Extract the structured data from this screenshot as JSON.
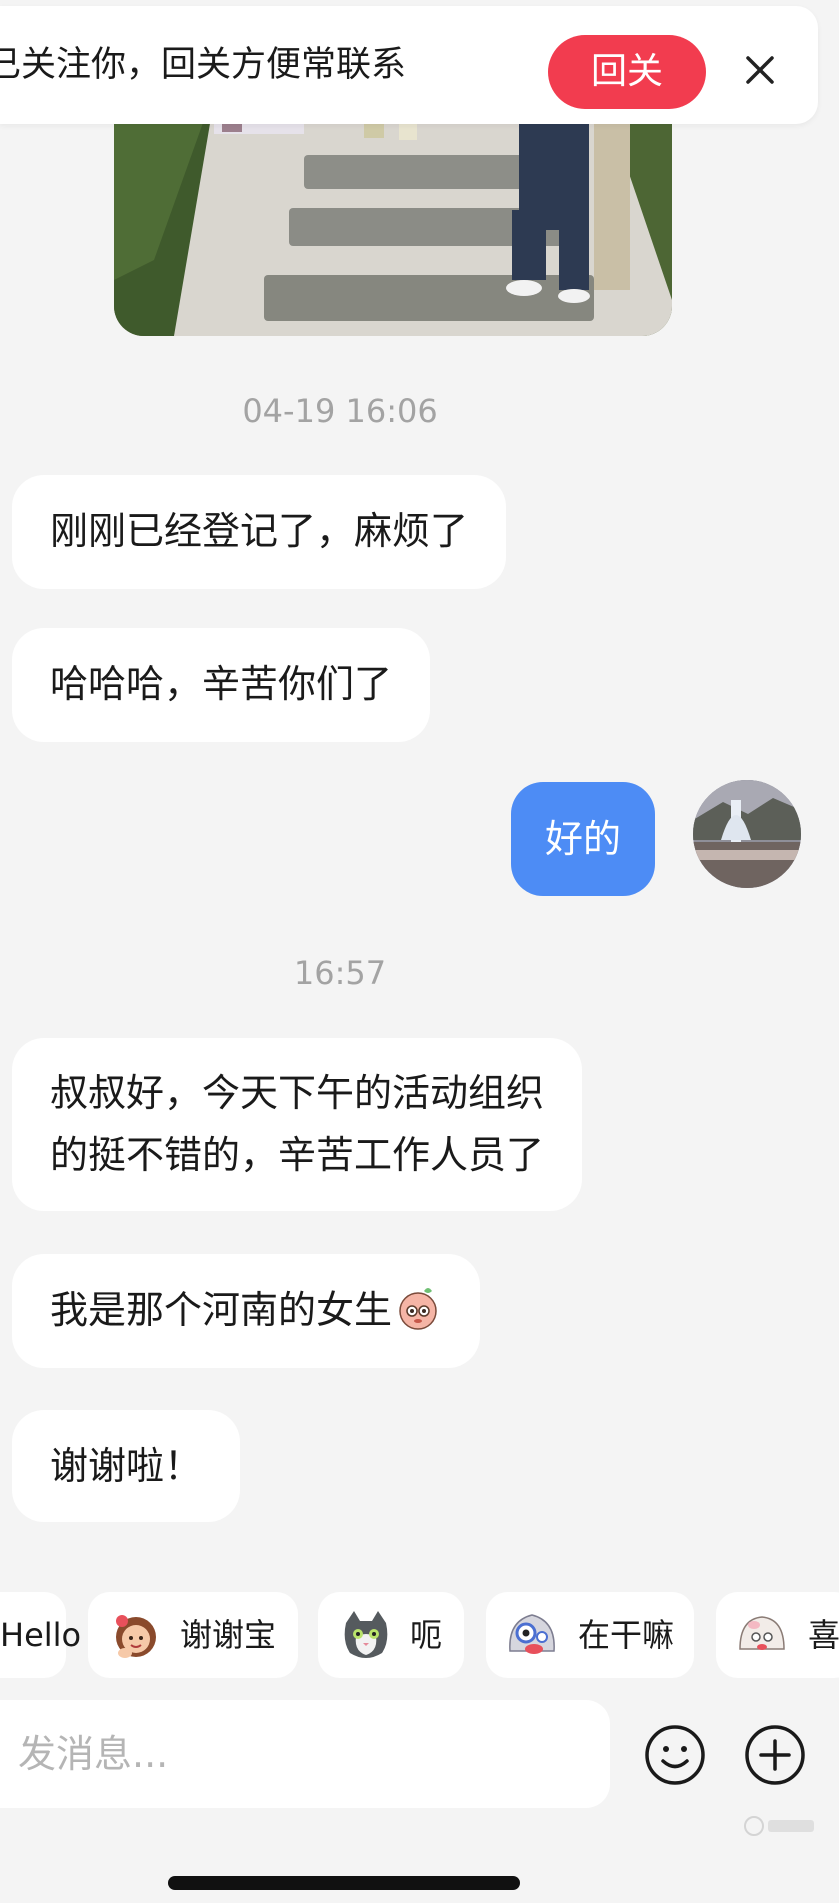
{
  "follow_banner": {
    "text": "已关注你，回关方便常联系",
    "button_label": "回关"
  },
  "conversation": {
    "timestamps": [
      "04-19 16:06",
      "16:57"
    ],
    "messages": [
      {
        "from": "other",
        "text": "刚刚已经登记了，麻烦了"
      },
      {
        "from": "other",
        "text": "哈哈哈，辛苦你们了"
      },
      {
        "from": "me",
        "text": "好的"
      },
      {
        "from": "other",
        "lines": [
          "叔叔好，今天下午的活动组织",
          "的挺不错的，辛苦工作人员了"
        ]
      },
      {
        "from": "other",
        "text": "我是那个河南的女生",
        "emoji": "blushing-sticker-icon"
      },
      {
        "from": "other",
        "text": "谢谢啦！"
      }
    ]
  },
  "quick_replies": [
    {
      "label": "Hello",
      "icon": null
    },
    {
      "label": "谢谢宝",
      "icon": "thanks-girl-sticker-icon"
    },
    {
      "label": "呃",
      "icon": "cat-sticker-icon"
    },
    {
      "label": "在干嘛",
      "icon": "peeking-sticker-icon"
    },
    {
      "label": "喜",
      "icon": "happy-sticker-icon"
    }
  ],
  "composer": {
    "placeholder": "发消息..."
  },
  "colors": {
    "background": "#f4f4f4",
    "accent_red": "#f23c4f",
    "my_bubble": "#4d8cf5"
  }
}
